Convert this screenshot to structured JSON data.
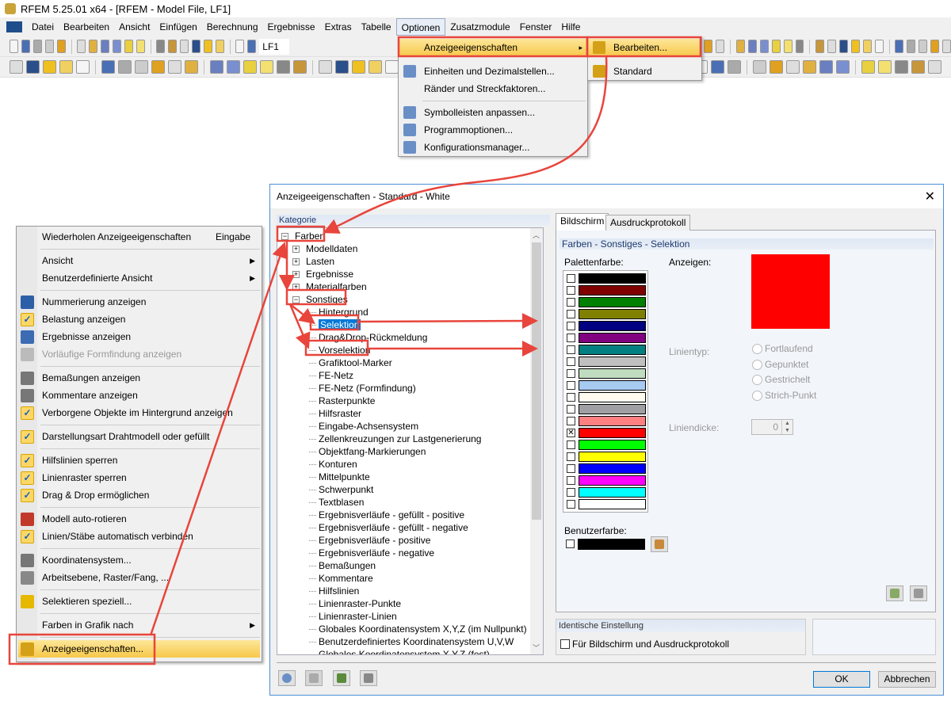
{
  "app": {
    "title": "RFEM 5.25.01 x64 - [RFEM - Model File, LF1]"
  },
  "menubar": [
    "Datei",
    "Bearbeiten",
    "Ansicht",
    "Einfügen",
    "Berechnung",
    "Ergebnisse",
    "Extras",
    "Tabelle",
    "Optionen",
    "Zusatzmodule",
    "Fenster",
    "Hilfe"
  ],
  "toolbar": {
    "load_case": "LF1"
  },
  "options_menu": [
    {
      "label": "Anzeigeeigenschaften",
      "icon": "none",
      "submenu": true,
      "highlighted": true
    },
    {
      "label": "Einheiten und Dezimalstellen...",
      "icon": "ruler-icon"
    },
    {
      "label": "Ränder und Streckfaktoren...",
      "icon": "none"
    },
    {
      "separator": true
    },
    {
      "label": "Symbolleisten anpassen...",
      "icon": "tools-icon"
    },
    {
      "label": "Programmoptionen...",
      "icon": "options-icon"
    },
    {
      "label": "Konfigurationsmanager...",
      "icon": "gears-icon"
    }
  ],
  "submenu": [
    {
      "label": "Bearbeiten...",
      "highlighted": true,
      "icon": "display-properties-icon"
    },
    {
      "label": "Standard",
      "icon": "display-properties-icon"
    }
  ],
  "dialog": {
    "title": "Anzeigeeigenschaften - Standard - White",
    "kategorie": "Kategorie",
    "tree": [
      {
        "label": "Farben",
        "level": 0,
        "expander": "minus",
        "boxed": true
      },
      {
        "label": "Modelldaten",
        "level": 1,
        "expander": "plus"
      },
      {
        "label": "Lasten",
        "level": 1,
        "expander": "plus"
      },
      {
        "label": "Ergebnisse",
        "level": 1,
        "expander": "plus"
      },
      {
        "label": "Materialfarben",
        "level": 1,
        "expander": "plus"
      },
      {
        "label": "Sonstiges",
        "level": 1,
        "expander": "minus",
        "boxed": true
      },
      {
        "label": "Hintergrund",
        "level": 2
      },
      {
        "label": "Selektion",
        "level": 2,
        "selected": true,
        "boxed": true
      },
      {
        "label": "Drag&Drop-Rückmeldung",
        "level": 2
      },
      {
        "label": "Vorselektion",
        "level": 2,
        "boxed": true
      },
      {
        "label": "Grafiktool-Marker",
        "level": 2
      },
      {
        "label": "FE-Netz",
        "level": 2
      },
      {
        "label": "FE-Netz (Formfindung)",
        "level": 2
      },
      {
        "label": "Rasterpunkte",
        "level": 2
      },
      {
        "label": "Hilfsraster",
        "level": 2
      },
      {
        "label": "Eingabe-Achsensystem",
        "level": 2
      },
      {
        "label": "Zellenkreuzungen zur Lastgenerierung",
        "level": 2
      },
      {
        "label": "Objektfang-Markierungen",
        "level": 2
      },
      {
        "label": "Konturen",
        "level": 2
      },
      {
        "label": "Mittelpunkte",
        "level": 2
      },
      {
        "label": "Schwerpunkt",
        "level": 2
      },
      {
        "label": "Textblasen",
        "level": 2
      },
      {
        "label": "Ergebnisverläufe - gefüllt - positive",
        "level": 2
      },
      {
        "label": "Ergebnisverläufe - gefüllt - negative",
        "level": 2
      },
      {
        "label": "Ergebnisverläufe - positive",
        "level": 2
      },
      {
        "label": "Ergebnisverläufe - negative",
        "level": 2
      },
      {
        "label": "Bemaßungen",
        "level": 2
      },
      {
        "label": "Kommentare",
        "level": 2
      },
      {
        "label": "Hilfslinien",
        "level": 2
      },
      {
        "label": "Linienraster-Punkte",
        "level": 2
      },
      {
        "label": "Linienraster-Linien",
        "level": 2
      },
      {
        "label": "Globales Koordinatensystem X,Y,Z (im Nullpunkt)",
        "level": 2
      },
      {
        "label": "Benutzerdefiniertes Koordinatensystem U,V,W",
        "level": 2
      },
      {
        "label": "Globales Koordinatensystem X,Y,Z (fest)",
        "level": 2
      }
    ],
    "tabs": [
      {
        "label": "Bildschirm",
        "active": true
      },
      {
        "label": "Ausdruckprotokoll"
      }
    ],
    "section_header": "Farben - Sonstiges - Selektion",
    "palette_label": "Palettenfarbe:",
    "palette": [
      {
        "color": "#000000"
      },
      {
        "color": "#800000"
      },
      {
        "color": "#008000"
      },
      {
        "color": "#808000"
      },
      {
        "color": "#000080"
      },
      {
        "color": "#800080"
      },
      {
        "color": "#008080"
      },
      {
        "color": "#c0c0c0"
      },
      {
        "color": "#c0dcc0"
      },
      {
        "color": "#a6caf0"
      },
      {
        "color": "#fffbf0"
      },
      {
        "color": "#a0a0a4"
      },
      {
        "color": "#ff8080"
      },
      {
        "color": "#ff0000",
        "checked": true
      },
      {
        "color": "#00ff00"
      },
      {
        "color": "#ffff00"
      },
      {
        "color": "#0000ff"
      },
      {
        "color": "#ff00ff"
      },
      {
        "color": "#00ffff"
      },
      {
        "color": "#ffffff"
      }
    ],
    "anzeigen_label": "Anzeigen:",
    "anzeigen_color": "#ff0000",
    "linientyp_label": "Linientyp:",
    "linientyp_options": [
      "Fortlaufend",
      "Gepunktet",
      "Gestrichelt",
      "Strich-Punkt"
    ],
    "liniendicke_label": "Liniendicke:",
    "liniendicke_value": "0",
    "benutzerfarbe_label": "Benutzerfarbe:",
    "benutzerfarbe_color": "#000000",
    "identische_header": "Identische Einstellung",
    "identische_checkbox": "Für Bildschirm und Ausdruckprotokoll",
    "ok": "OK",
    "cancel": "Abbrechen"
  },
  "context_menu": [
    {
      "label": "Wiederholen Anzeigeeigenschaften",
      "shortcut": "Eingabe"
    },
    {
      "separator": true
    },
    {
      "label": "Ansicht",
      "submenu": true
    },
    {
      "label": "Benutzerdefinierte Ansicht",
      "submenu": true
    },
    {
      "separator": true
    },
    {
      "label": "Nummerierung anzeigen",
      "icon": "numbering-icon",
      "iconColor": "#2d5fa8"
    },
    {
      "label": "Belastung anzeigen",
      "icon": "load-icon",
      "checked": true
    },
    {
      "label": "Ergebnisse anzeigen",
      "icon": "results-eye-icon",
      "iconColor": "#3b6bb3"
    },
    {
      "label": "Vorläufige Formfindung anzeigen",
      "icon": "formfinding-icon",
      "disabled": true,
      "iconColor": "#bbbbbb"
    },
    {
      "separator": true
    },
    {
      "label": "Bemaßungen anzeigen",
      "icon": "dimension-icon",
      "iconColor": "#777777"
    },
    {
      "label": "Kommentare anzeigen",
      "icon": "comment-icon",
      "iconColor": "#777777"
    },
    {
      "label": "Verborgene Objekte im Hintergrund anzeigen",
      "icon": "check-icon",
      "checked": true
    },
    {
      "separator": true
    },
    {
      "label": "Darstellungsart Drahtmodell oder gefüllt",
      "icon": "check-icon",
      "checked": true
    },
    {
      "separator": true
    },
    {
      "label": "Hilfslinien sperren",
      "icon": "guideline-lock-icon",
      "checked": true
    },
    {
      "label": "Linienraster sperren",
      "icon": "check-icon",
      "checked": true
    },
    {
      "label": "Drag & Drop ermöglichen",
      "icon": "drag-drop-icon",
      "checked": true
    },
    {
      "separator": true
    },
    {
      "label": "Modell auto-rotieren",
      "icon": "rotate-eye-icon",
      "iconColor": "#c0392b"
    },
    {
      "label": "Linien/Stäbe automatisch verbinden",
      "icon": "auto-connect-icon",
      "checked": true
    },
    {
      "separator": true
    },
    {
      "label": "Koordinatensystem...",
      "icon": "coordinate-icon",
      "iconColor": "#777777"
    },
    {
      "label": "Arbeitsebene, Raster/Fang, ...",
      "icon": "workplane-icon",
      "iconColor": "#888888"
    },
    {
      "separator": true
    },
    {
      "label": "Selektieren speziell...",
      "icon": "select-special-icon",
      "iconColor": "#e6b800"
    },
    {
      "separator": true
    },
    {
      "label": "Farben in Grafik nach",
      "submenu": true
    },
    {
      "separator": true
    },
    {
      "label": "Anzeigeeigenschaften...",
      "icon": "display-properties-icon",
      "highlighted": true,
      "iconColor": "#d4a017"
    }
  ],
  "colors": {
    "annotation": "#e8453c",
    "selection": "#0078d7",
    "highlight": "#f7c84a"
  }
}
